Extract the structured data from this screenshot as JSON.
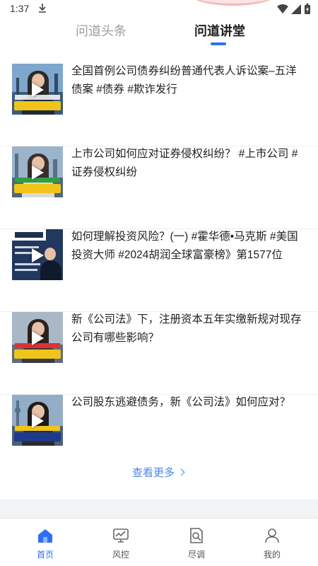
{
  "status_bar": {
    "time": "1:37"
  },
  "tabs": [
    {
      "label": "问道头条",
      "active": false
    },
    {
      "label": "问道讲堂",
      "active": true
    }
  ],
  "videos": [
    {
      "title": "全国首例公司债券纠纷普通代表人诉讼案–五洋债案 #债券 #欺诈发行",
      "thumb_caption": "五洋债案"
    },
    {
      "title": "上市公司如何应对证券侵权纠纷？ #上市公司 #证券侵权纠纷",
      "thumb_caption": "证券侵权纠纷"
    },
    {
      "title": "如何理解投资风险？(一) #霍华德•马克斯 #美国投资大师 #2024胡润全球富豪榜》第1577位",
      "thumb_caption": "投资风险"
    },
    {
      "title": "新《公司法》下，注册资本五年实缴新规对现存公司有哪些影响？",
      "thumb_caption": "有哪些影响"
    },
    {
      "title": "公司股东逃避债务，新《公司法》如何应对？",
      "thumb_caption": "如何应对"
    }
  ],
  "more_label": "查看更多",
  "bottom_nav": [
    {
      "label": "首页",
      "icon": "home-icon",
      "active": true
    },
    {
      "label": "风控",
      "icon": "risk-control-icon",
      "active": false
    },
    {
      "label": "尽调",
      "icon": "due-diligence-icon",
      "active": false
    },
    {
      "label": "我的",
      "icon": "profile-icon",
      "active": false
    }
  ],
  "colors": {
    "accent": "#2d6ff6",
    "link": "#4a86e8",
    "muted_tab": "#9aa0a6"
  }
}
